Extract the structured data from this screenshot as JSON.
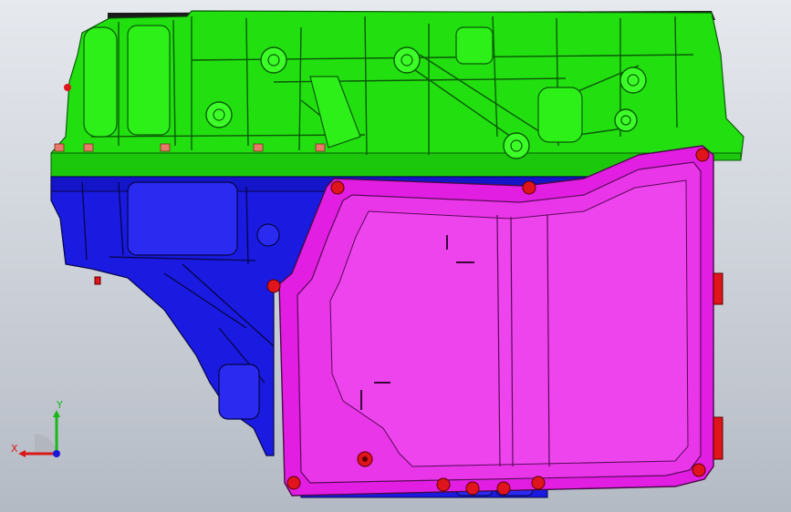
{
  "viewport": {
    "background_top": "#e6e9ee",
    "background_bottom": "#b4bac4"
  },
  "model": {
    "parts": [
      {
        "name": "upper-housing",
        "color": "#22e010"
      },
      {
        "name": "lower-housing",
        "color": "#1a1ae0"
      },
      {
        "name": "oil-pan",
        "color": "#e21ee2"
      },
      {
        "name": "bolt-heads",
        "color": "#e0141c"
      }
    ]
  },
  "triad": {
    "x_label": "X",
    "y_label": "Y",
    "x_color": "#d81818",
    "y_color": "#18b818",
    "z_color": "#1818d8",
    "icon": "coordinate-triad-icon"
  }
}
